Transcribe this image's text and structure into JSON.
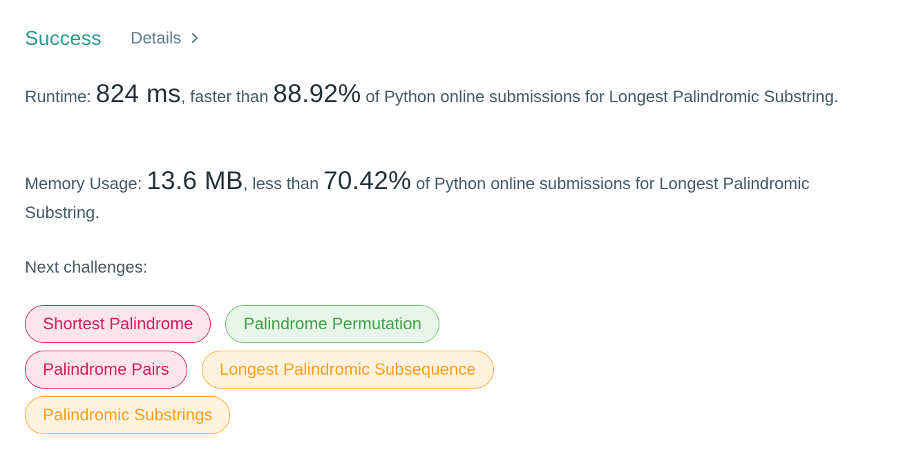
{
  "header": {
    "status": "Success",
    "details_label": "Details",
    "details_icon": "chevron-right-icon"
  },
  "runtime": {
    "label": "Runtime: ",
    "value": "824 ms",
    "comparison": ", faster than ",
    "percent": "88.92%",
    "suffix": " of Python online submissions for Longest Palindromic Substring."
  },
  "memory": {
    "label": "Memory Usage: ",
    "value": "13.6 MB",
    "comparison": ", less than ",
    "percent": "70.42%",
    "suffix": " of Python online submissions for Longest Palindromic Substring."
  },
  "next": {
    "label": "Next challenges:",
    "challenges": [
      {
        "title": "Shortest Palindrome",
        "difficulty": "hard"
      },
      {
        "title": "Palindrome Permutation",
        "difficulty": "easy"
      },
      {
        "title": "Palindrome Pairs",
        "difficulty": "hard"
      },
      {
        "title": "Longest Palindromic Subsequence",
        "difficulty": "medium"
      },
      {
        "title": "Palindromic Substrings",
        "difficulty": "medium"
      }
    ]
  },
  "colors": {
    "success": "#2a9d8f",
    "hard": "#d81b60",
    "easy": "#43a047",
    "medium": "#ff9f1a"
  }
}
